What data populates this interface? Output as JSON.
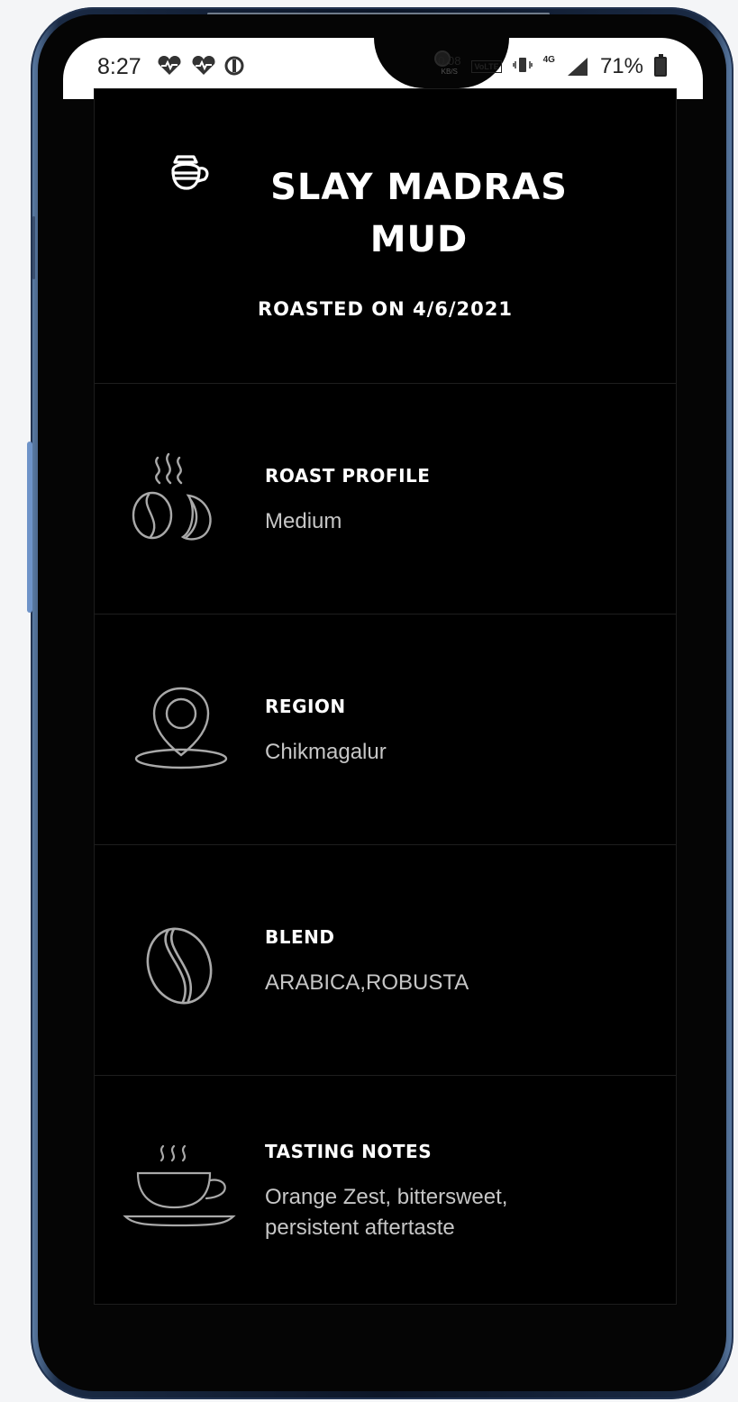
{
  "status_bar": {
    "time": "8:27",
    "net_speed": "0.08",
    "net_speed_unit": "KB/S",
    "volte": "VoLTE",
    "network_type": "4G",
    "battery": "71%"
  },
  "product": {
    "title_line1": "SLAY MADRAS",
    "title_line2": "MUD",
    "roasted_on": "ROASTED ON 4/6/2021"
  },
  "details": {
    "roast_profile": {
      "label": "ROAST PROFILE",
      "value": "Medium",
      "icon": "roasting-beans-icon"
    },
    "region": {
      "label": "REGION",
      "value": "Chikmagalur",
      "icon": "map-pin-icon"
    },
    "blend": {
      "label": "BLEND",
      "value": "ARABICA,ROBUSTA",
      "icon": "coffee-bean-icon"
    },
    "tasting_notes": {
      "label": "TASTING NOTES",
      "value_line1": "Orange Zest, bittersweet,",
      "value_line2": "persistent aftertaste",
      "icon": "coffee-cup-icon"
    }
  },
  "colors": {
    "background": "#000000",
    "label": "#ffffff",
    "value": "#c6c6c6",
    "icon_stroke": "#a9a9a9",
    "phone_frame": "#1a2a44"
  }
}
